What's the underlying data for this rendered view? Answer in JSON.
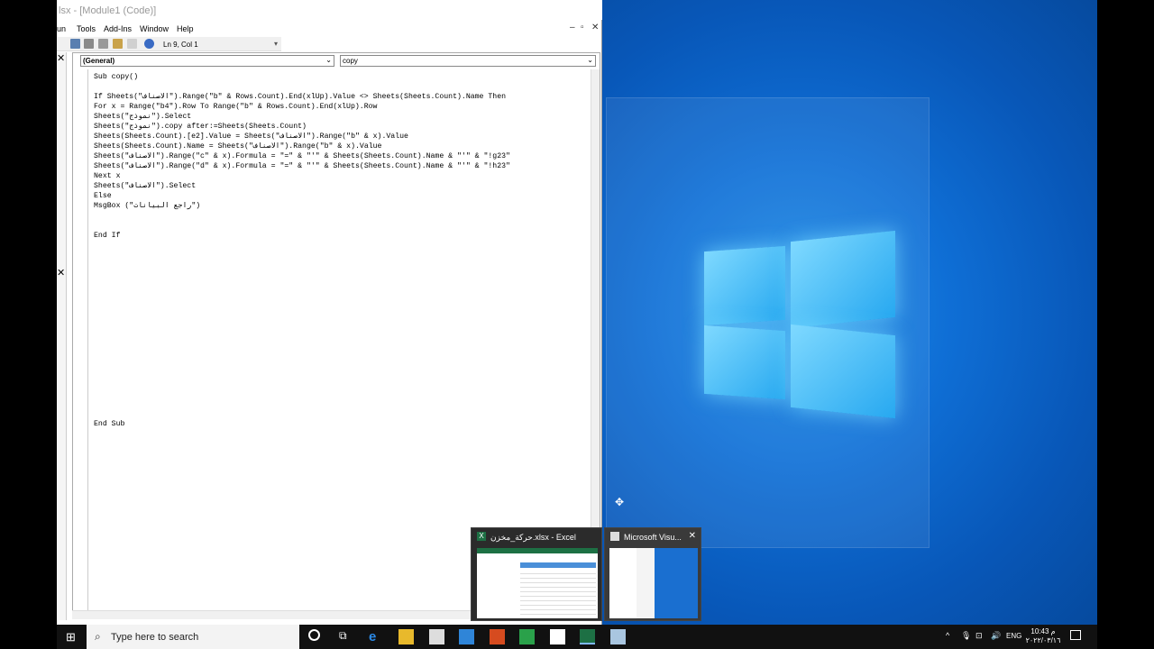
{
  "window": {
    "title": "lsx - [Module1 (Code)]",
    "menu": [
      "un",
      "Tools",
      "Add-Ins",
      "Window",
      "Help"
    ],
    "status_position": "Ln 9, Col 1"
  },
  "editor": {
    "object_combo": "(General)",
    "procedure_combo": "copy",
    "code_lines": [
      "Sub copy()",
      "",
      "If Sheets(\"الاصناف\").Range(\"b\" & Rows.Count).End(xlUp).Value <> Sheets(Sheets.Count).Name Then",
      "For x = Range(\"b4\").Row To Range(\"b\" & Rows.Count).End(xlUp).Row",
      "Sheets(\"نموذج\").Select",
      "Sheets(\"نموذج\").copy after:=Sheets(Sheets.Count)",
      "Sheets(Sheets.Count).[e2].Value = Sheets(\"الاصناف\").Range(\"b\" & x).Value",
      "Sheets(Sheets.Count).Name = Sheets(\"الاصناف\").Range(\"b\" & x).Value",
      "Sheets(\"الاصناف\").Range(\"c\" & x).Formula = \"=\" & \"'\" & Sheets(Sheets.Count).Name & \"'\" & \"!g23\"",
      "Sheets(\"الاصناف\").Range(\"d\" & x).Formula = \"=\" & \"'\" & Sheets(Sheets.Count).Name & \"'\" & \"!h23\"",
      "Next x",
      "Sheets(\"الاصناف\").Select",
      "Else",
      "MsgBox (\"راجع البيانات\")",
      "",
      "",
      "End If",
      "",
      "",
      "",
      "",
      "",
      "",
      "",
      "",
      "",
      "",
      "",
      "",
      "",
      "",
      "",
      "",
      "",
      "",
      "End Sub"
    ]
  },
  "taskbar": {
    "search_placeholder": "Type here to search",
    "language": "ENG",
    "time": "10:43 م",
    "date": "٢٠٢٢/٠٣/١٦",
    "thumbnails": [
      {
        "title": "حركة_مخزن.xlsx - Excel"
      },
      {
        "title": "Microsoft Visu..."
      }
    ]
  },
  "colors": {
    "desktop": "#0f6fd6",
    "taskbar": "#111111",
    "excel_green": "#1d7044"
  }
}
